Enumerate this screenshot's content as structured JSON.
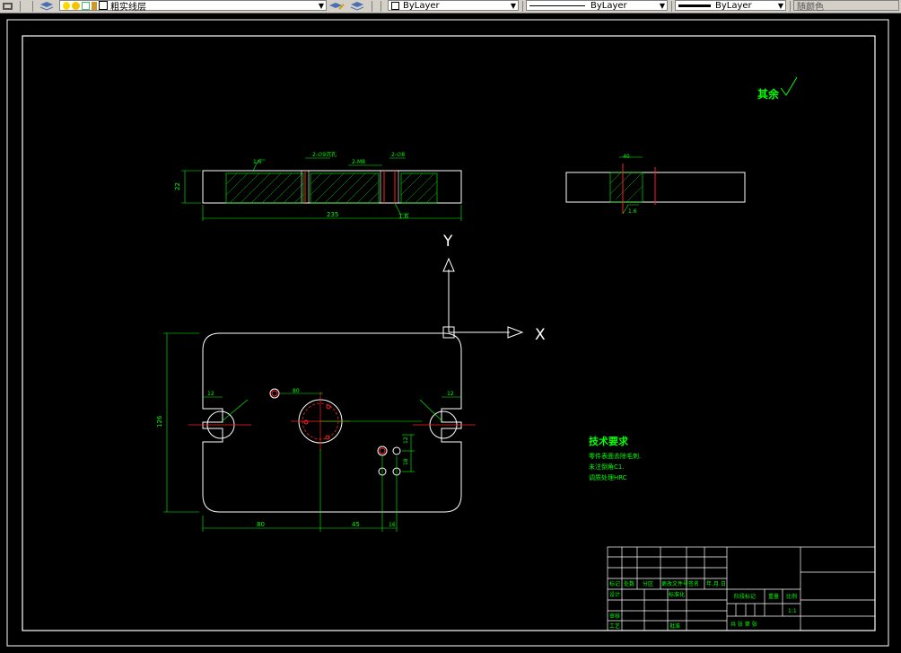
{
  "toolbar": {
    "layer_name": "粗实线层",
    "color_combo": "ByLayer",
    "linetype_combo": "ByLayer",
    "lineweight_combo": "ByLayer",
    "plotstyle_combo": "随颜色"
  },
  "drawing": {
    "roughness_note": "其余",
    "tech_title": "技术要求",
    "tech_lines": [
      "零件表面去除毛刺.",
      "未注倒角C1.",
      "调质处理HRC"
    ],
    "axis_x": "X",
    "axis_y": "Y",
    "dims": {
      "overall_width": "235",
      "thickness": "22",
      "height": "126",
      "slot_w_left": "12",
      "slot_w_right": "12",
      "bottom_a": "80",
      "bottom_b": "45",
      "bottom_c": "16",
      "right_v1": "12",
      "right_v2": "18",
      "top_dim1": "2-∅9沉孔",
      "top_dim2": "2-M8",
      "top_dim3": "2-∅8",
      "rough_left": "1.6",
      "rough_right": "1.6",
      "side_dim": "40",
      "side_rough": "1.6",
      "hole_dim": "80"
    },
    "title_block": {
      "labels": [
        "标记",
        "处数",
        "分区",
        "更改文件号",
        "签名",
        "年.月.日",
        "设计",
        "标准化",
        "审核",
        "工艺",
        "批准",
        "阶段标记",
        "重量",
        "比例"
      ],
      "scale": "1:1",
      "sheet": "共  张  第  张"
    }
  }
}
